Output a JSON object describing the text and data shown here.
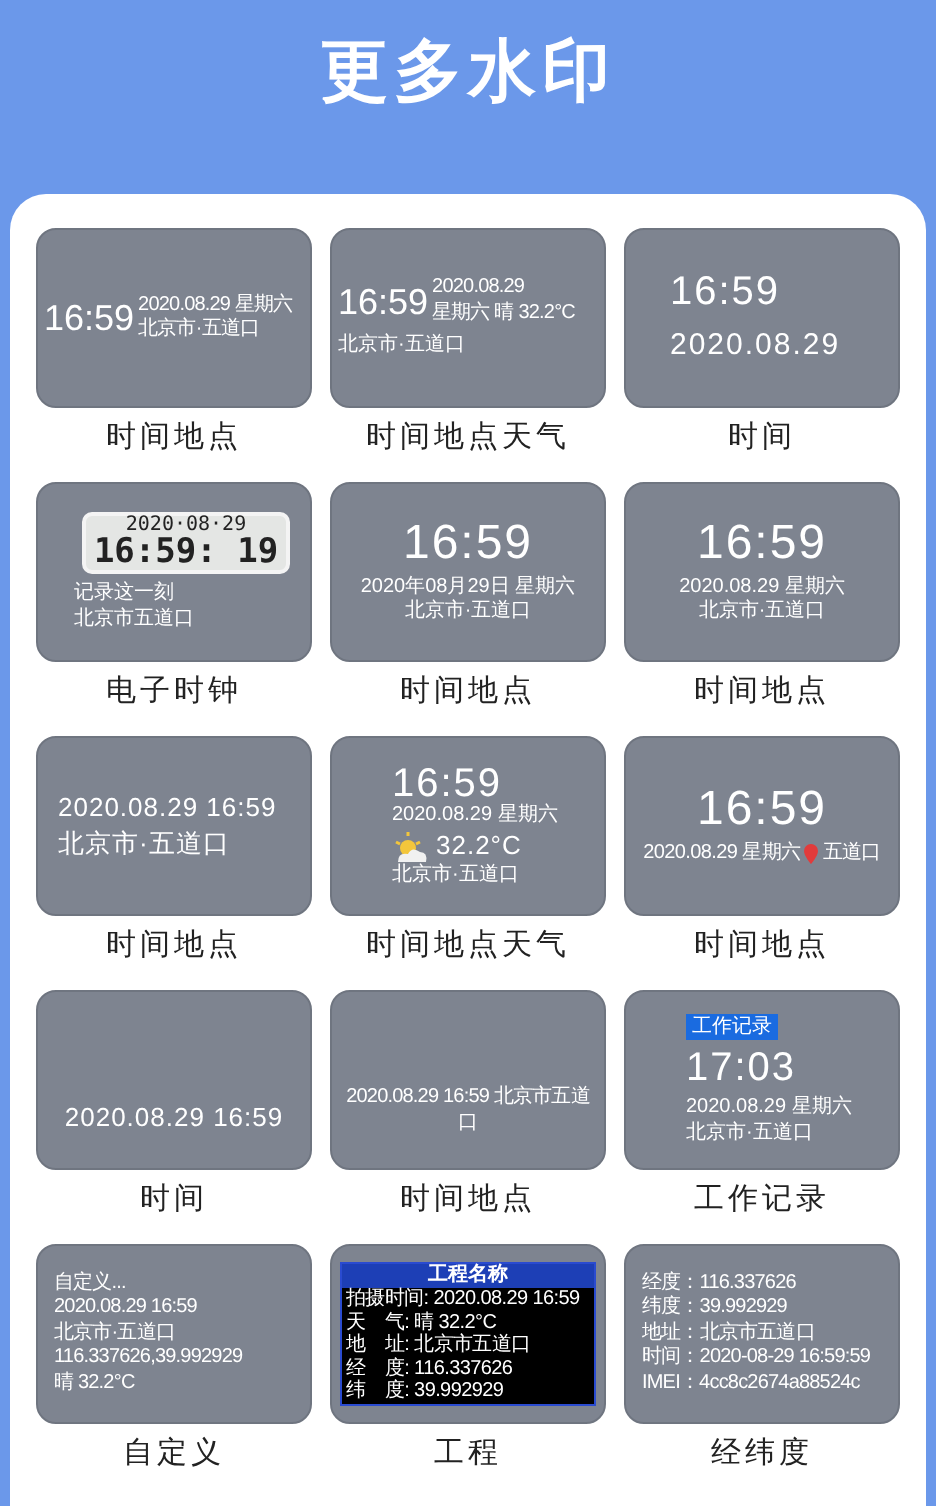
{
  "title": "更多水印",
  "cards": [
    {
      "kind": "inline",
      "time": "16:59",
      "side": [
        "2020.08.29 星期六",
        "北京市·五道口"
      ],
      "label": "时间地点"
    },
    {
      "kind": "inline",
      "time": "16:59",
      "side": [
        "2020.08.29",
        "星期六 晴 32.2°C"
      ],
      "below": [
        "北京市·五道口"
      ],
      "label": "时间地点天气"
    },
    {
      "kind": "time-date",
      "time": "16:59",
      "lines": [
        "2020.08.29"
      ],
      "label": "时间"
    },
    {
      "kind": "digital",
      "lcd_date": "2020·08·29",
      "lcd_time": "16:59: 19",
      "lines": [
        "记录这一刻",
        "北京市五道口"
      ],
      "label": "电子时钟"
    },
    {
      "kind": "stack",
      "time": "16:59",
      "lines": [
        "2020年08月29日 星期六",
        "北京市·五道口"
      ],
      "label": "时间地点"
    },
    {
      "kind": "stack",
      "time": "16:59",
      "lines": [
        "2020.08.29 星期六",
        "北京市·五道口"
      ],
      "label": "时间地点"
    },
    {
      "kind": "left-large",
      "lines": [
        "2020.08.29 16:59",
        "北京市·五道口"
      ],
      "label": "时间地点"
    },
    {
      "kind": "weather",
      "time": "16:59",
      "lines": [
        "2020.08.29 星期六"
      ],
      "temp": "32.2°C",
      "place": "北京市·五道口",
      "label": "时间地点天气"
    },
    {
      "kind": "pin",
      "time": "16:59",
      "lines": [
        "2020.08.29 星期六"
      ],
      "place": "五道口",
      "label": "时间地点"
    },
    {
      "kind": "bottom-large",
      "lines": [
        "2020.08.29 16:59"
      ],
      "label": "时间"
    },
    {
      "kind": "bottom-small",
      "lines": [
        "2020.08.29 16:59 北京市五道口"
      ],
      "label": "时间地点"
    },
    {
      "kind": "work",
      "badge": "工作记录",
      "time": "17:03",
      "lines": [
        "2020.08.29 星期六",
        "北京市·五道口"
      ],
      "label": "工作记录"
    },
    {
      "kind": "left-small",
      "lines": [
        "自定义...",
        "2020.08.29 16:59",
        "北京市·五道口",
        "116.337626,39.992929",
        "晴 32.2°C"
      ],
      "label": "自定义"
    },
    {
      "kind": "engineering",
      "header": "工程名称",
      "rows": [
        {
          "key": "拍摄时间:",
          "value": "2020.08.29 16:59"
        },
        {
          "key": "天　气:",
          "value": "晴 32.2°C"
        },
        {
          "key": "地　址:",
          "value": "北京市五道口"
        },
        {
          "key": "经　度:",
          "value": "116.337626"
        },
        {
          "key": "纬　度:",
          "value": "39.992929"
        }
      ],
      "label": "工程"
    },
    {
      "kind": "left-small",
      "lines": [
        "经度：116.337626",
        "纬度：39.992929",
        "地址：北京市五道口",
        "时间：2020-08-29 16:59:59",
        "IMEI：4cc8c2674a88524c"
      ],
      "label": "经纬度"
    }
  ]
}
